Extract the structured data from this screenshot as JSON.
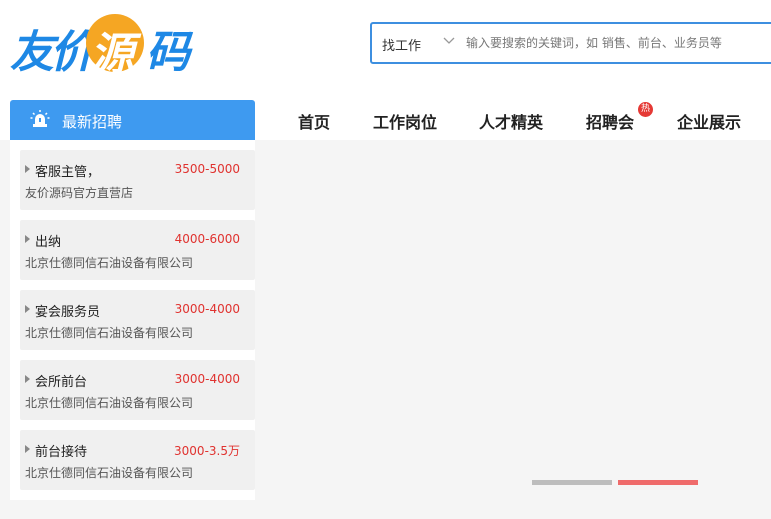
{
  "logo": {
    "part1": "友价",
    "part2": "源",
    "part3": "码"
  },
  "search": {
    "type_label": "找工作",
    "placeholder": "输入要搜索的关键词，如 销售、前台、业务员等",
    "value": ""
  },
  "nav": {
    "items": [
      {
        "label": "首页"
      },
      {
        "label": "工作岗位"
      },
      {
        "label": "人才精英"
      },
      {
        "label": "招聘会"
      },
      {
        "label": "企业展示"
      }
    ],
    "hot_badge": "热"
  },
  "sidebar": {
    "title": "最新招聘",
    "jobs": [
      {
        "name": "客服主管，",
        "salary": "3500-5000",
        "company": "友价源码官方直营店"
      },
      {
        "name": "出纳",
        "salary": "4000-6000",
        "company": "北京仕德同信石油设备有限公司"
      },
      {
        "name": "宴会服务员",
        "salary": "3000-4000",
        "company": "北京仕德同信石油设备有限公司"
      },
      {
        "name": "会所前台",
        "salary": "3000-4000",
        "company": "北京仕德同信石油设备有限公司"
      },
      {
        "name": "前台接待",
        "salary": "3000-3.5万",
        "company": "北京仕德同信石油设备有限公司"
      }
    ]
  },
  "colors": {
    "accent": "#3e9af0",
    "salary": "#e0322f",
    "logo_orange": "#f5a623"
  },
  "banner": {
    "slide_count": 2,
    "active_slide": 2
  }
}
